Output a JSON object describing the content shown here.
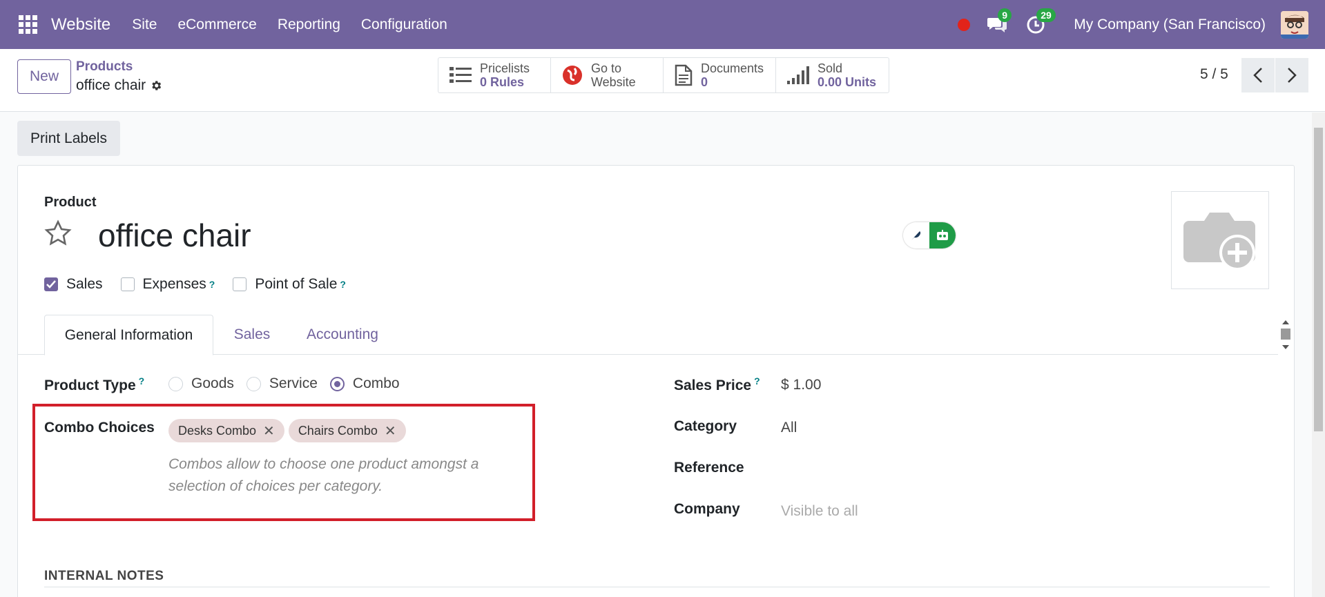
{
  "navbar": {
    "brand": "Website",
    "menu": [
      "Site",
      "eCommerce",
      "Reporting",
      "Configuration"
    ],
    "messages_count": "9",
    "activities_count": "29",
    "company": "My Company (San Francisco)",
    "bg_color": "#71639e"
  },
  "control": {
    "new_label": "New",
    "breadcrumb_parent": "Products",
    "breadcrumb_current": "office chair",
    "stats": [
      {
        "icon": "list-icon",
        "label": "Pricelists",
        "value": "0  Rules"
      },
      {
        "icon": "globe-icon",
        "label": "Go to",
        "value": "Website"
      },
      {
        "icon": "document-icon",
        "label": "Documents",
        "value": "0"
      },
      {
        "icon": "bar-chart-icon",
        "label": "Sold",
        "value": "0.00  Units"
      }
    ],
    "pager": "5 / 5"
  },
  "actions": {
    "print_labels": "Print Labels"
  },
  "form": {
    "product_label": "Product",
    "product_name": "office chair",
    "checkboxes": [
      {
        "label": "Sales",
        "checked": true,
        "help": false
      },
      {
        "label": "Expenses",
        "checked": false,
        "help": true
      },
      {
        "label": "Point of Sale",
        "checked": false,
        "help": true
      }
    ],
    "help_mark": "?",
    "tabs": [
      "General Information",
      "Sales",
      "Accounting"
    ],
    "product_type_label": "Product Type",
    "product_type_options": [
      "Goods",
      "Service",
      "Combo"
    ],
    "product_type_selected": "Combo",
    "combo_choices_label": "Combo Choices",
    "combo_tags": [
      "Desks Combo",
      "Chairs Combo"
    ],
    "combo_help": "Combos allow to choose one product amongst a selection of choices per category.",
    "sales_price_label": "Sales Price",
    "sales_price_value": "$ 1.00",
    "category_label": "Category",
    "category_value": "All",
    "reference_label": "Reference",
    "company_label": "Company",
    "company_placeholder": "Visible to all",
    "internal_notes_title": "INTERNAL NOTES"
  },
  "colors": {
    "accent": "#71639e",
    "highlight": "#d21f2a",
    "badge": "#28a745"
  }
}
